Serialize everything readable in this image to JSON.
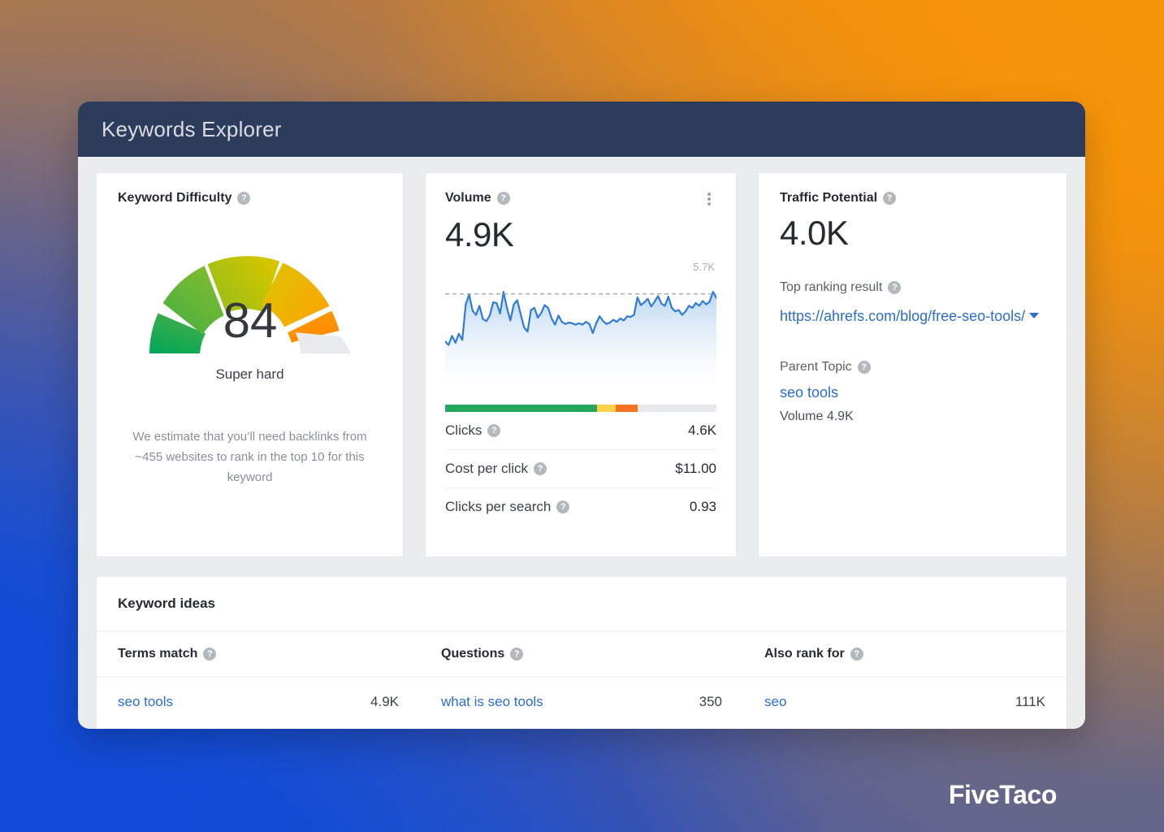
{
  "app": {
    "title": "Keywords Explorer",
    "header_bg": "#2E3C5C",
    "page_bg": "#EBECEE",
    "link_color": "#2B6DCB"
  },
  "background": {
    "top_left": "#B07A4A",
    "top_right": "#F7920B",
    "bottom_left": "#1549C9",
    "bottom_right": "#5D638E"
  },
  "keyword_difficulty": {
    "title": "Keyword Difficulty",
    "help": "?",
    "value": "84",
    "rating": "Super hard",
    "note": "We estimate that you’ll need backlinks from ~455 websites to rank in the top 10 for this keyword",
    "gauge": {
      "score": 84,
      "segments": [
        {
          "name": "very-easy",
          "color_from": "#00A65A",
          "color_to": "#3FAE49"
        },
        {
          "name": "easy",
          "color_from": "#4CAF3F",
          "color_to": "#7CBB2E"
        },
        {
          "name": "medium",
          "color_from": "#A6C20F",
          "color_to": "#D2C400"
        },
        {
          "name": "hard",
          "color_from": "#F2B705",
          "color_to": "#FCA103"
        },
        {
          "name": "super-hard",
          "color_from": "#FB9A02",
          "color_to": "#FF8C00"
        },
        {
          "name": "remaining",
          "color_from": "#E8E9EA",
          "color_to": "#E8E9EA"
        }
      ]
    }
  },
  "volume": {
    "title": "Volume",
    "help": "?",
    "value": "4.9K",
    "menu_icon": "kebab-menu-icon",
    "chart_max_label": "5.7K",
    "bar_segments": [
      {
        "name": "green",
        "color": "#22A75D",
        "pct": 56
      },
      {
        "name": "yellow",
        "color": "#FDD24B",
        "pct": 7
      },
      {
        "name": "orange",
        "color": "#F5731F",
        "pct": 8
      },
      {
        "name": "grey",
        "color": "#E8E9EA",
        "pct": 29
      }
    ],
    "metrics": [
      {
        "label": "Clicks",
        "help": "?",
        "value": "4.6K"
      },
      {
        "label": "Cost per click",
        "help": "?",
        "value": "$11.00"
      },
      {
        "label": "Clicks per search",
        "help": "?",
        "value": "0.93"
      }
    ]
  },
  "traffic_potential": {
    "title": "Traffic Potential",
    "help": "?",
    "value": "4.0K",
    "top_ranking_label": "Top ranking result",
    "top_ranking_help": "?",
    "top_ranking_url": "https://ahrefs.com/blog/free-seo-tools/",
    "parent_topic_label": "Parent Topic",
    "parent_topic_help": "?",
    "parent_topic": "seo tools",
    "parent_topic_volume": "Volume 4.9K"
  },
  "keyword_ideas": {
    "title": "Keyword ideas",
    "columns": [
      {
        "label": "Terms match",
        "help": "?"
      },
      {
        "label": "Questions",
        "help": "?"
      },
      {
        "label": "Also rank for",
        "help": "?"
      }
    ],
    "rows": [
      {
        "keyword": "seo tools",
        "value": "4.9K"
      },
      {
        "keyword": "what is seo tools",
        "value": "350"
      },
      {
        "keyword": "seo",
        "value": "111K"
      }
    ]
  },
  "watermark": {
    "text": "FiveTaco"
  },
  "chart_data": {
    "type": "area",
    "title": "Volume",
    "ylabel": "",
    "xlabel": "",
    "ymax_label": "5.7K",
    "ylim": [
      0,
      5700
    ],
    "reference_line": 4900,
    "grid": false,
    "legend": "none",
    "line_color": "#2E7CD6",
    "fill_from": "#BFD9F2",
    "fill_to": "#FFFFFF",
    "values": [
      1500,
      1250,
      1900,
      1400,
      2050,
      1600,
      4150,
      4850,
      3700,
      3400,
      4050,
      3100,
      2950,
      3350,
      4300,
      4250,
      3500,
      5050,
      3900,
      3000,
      4150,
      4450,
      3450,
      2500,
      2200,
      3750,
      3900,
      3200,
      3550,
      4100,
      3900,
      3150,
      2700,
      3350,
      2900,
      2750,
      2850,
      2800,
      2700,
      2800,
      2700,
      2900,
      2750,
      2100,
      2800,
      3300,
      2950,
      2750,
      2850,
      3050,
      2900,
      3150,
      3000,
      3300,
      3250,
      3400,
      4650,
      4100,
      4300,
      4550,
      4000,
      4350,
      4750,
      4200,
      4050,
      4700,
      3900,
      3650,
      3750,
      3400,
      3650,
      4050,
      3900,
      4250,
      4050,
      4400,
      4150,
      4350,
      5050,
      4600
    ]
  }
}
